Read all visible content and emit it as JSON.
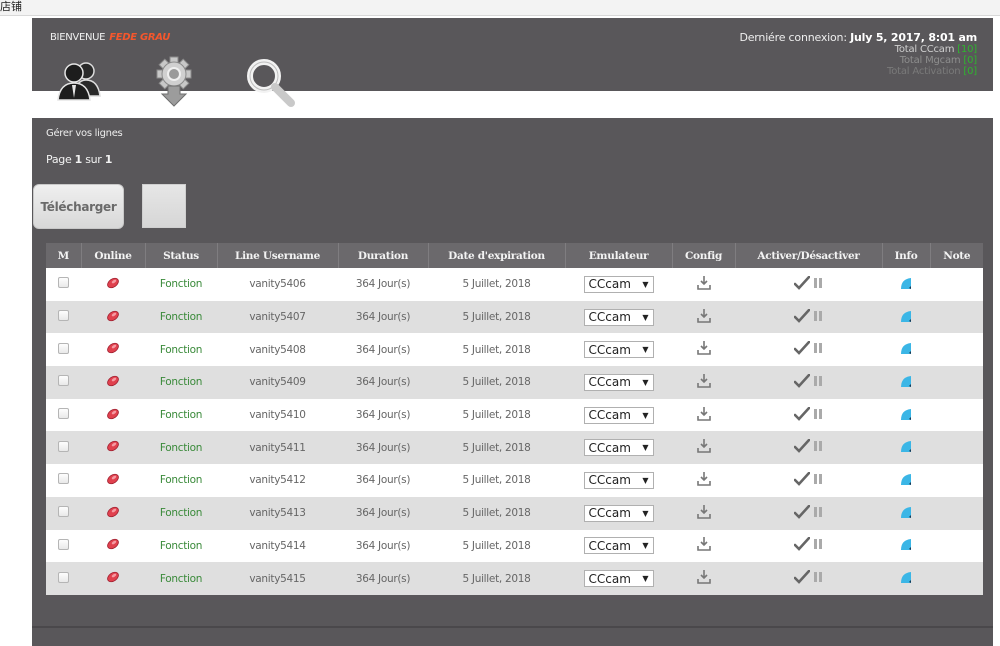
{
  "browser_bar": {
    "text": "店铺"
  },
  "header": {
    "welcome_label": "BIENVENUE",
    "user_name": "FEDE GRAU",
    "last_login_label": "Derniére connexion:",
    "last_login_value": "July 5, 2017, 8:01 am",
    "totals": [
      {
        "label": "Total CCcam",
        "value": "[10]"
      },
      {
        "label": "Total Mgcam",
        "value": "[0]"
      },
      {
        "label": "Total Activation",
        "value": "[0]"
      }
    ],
    "nav_icons": [
      "users-icon",
      "settings-download-icon",
      "search-icon"
    ]
  },
  "panel": {
    "title": "Gérer vos lignes",
    "page_prefix": "Page",
    "page_current": "1",
    "page_sep": "sur",
    "page_total": "1",
    "download_button": "Télécharger"
  },
  "table": {
    "columns": [
      "M",
      "Online",
      "Status",
      "Line Username",
      "Duration",
      "Date d'expiration",
      "Emulateur",
      "Config",
      "Activer/Désactiver",
      "Info",
      "Note"
    ],
    "rows": [
      {
        "username": "vanity5406",
        "status": "Fonction",
        "duration": "364 Jour(s)",
        "expiration": "5 Juillet, 2018",
        "emulator": "CCcam",
        "note": ""
      },
      {
        "username": "vanity5407",
        "status": "Fonction",
        "duration": "364 Jour(s)",
        "expiration": "5 Juillet, 2018",
        "emulator": "CCcam",
        "note": ""
      },
      {
        "username": "vanity5408",
        "status": "Fonction",
        "duration": "364 Jour(s)",
        "expiration": "5 Juillet, 2018",
        "emulator": "CCcam",
        "note": ""
      },
      {
        "username": "vanity5409",
        "status": "Fonction",
        "duration": "364 Jour(s)",
        "expiration": "5 Juillet, 2018",
        "emulator": "CCcam",
        "note": ""
      },
      {
        "username": "vanity5410",
        "status": "Fonction",
        "duration": "364 Jour(s)",
        "expiration": "5 Juillet, 2018",
        "emulator": "CCcam",
        "note": ""
      },
      {
        "username": "vanity5411",
        "status": "Fonction",
        "duration": "364 Jour(s)",
        "expiration": "5 Juillet, 2018",
        "emulator": "CCcam",
        "note": ""
      },
      {
        "username": "vanity5412",
        "status": "Fonction",
        "duration": "364 Jour(s)",
        "expiration": "5 Juillet, 2018",
        "emulator": "CCcam",
        "note": ""
      },
      {
        "username": "vanity5413",
        "status": "Fonction",
        "duration": "364 Jour(s)",
        "expiration": "5 Juillet, 2018",
        "emulator": "CCcam",
        "note": ""
      },
      {
        "username": "vanity5414",
        "status": "Fonction",
        "duration": "364 Jour(s)",
        "expiration": "5 Juillet, 2018",
        "emulator": "CCcam",
        "note": ""
      },
      {
        "username": "vanity5415",
        "status": "Fonction",
        "duration": "364 Jour(s)",
        "expiration": "5 Juillet, 2018",
        "emulator": "CCcam",
        "note": ""
      }
    ]
  },
  "colors": {
    "header_bg": "#59575a",
    "username_accent": "#f4572d",
    "total_value_green": "#2fb52f",
    "status_green": "#3a8a3a",
    "info_blue": "#3bb6e6",
    "online_red": "#e0414e"
  }
}
